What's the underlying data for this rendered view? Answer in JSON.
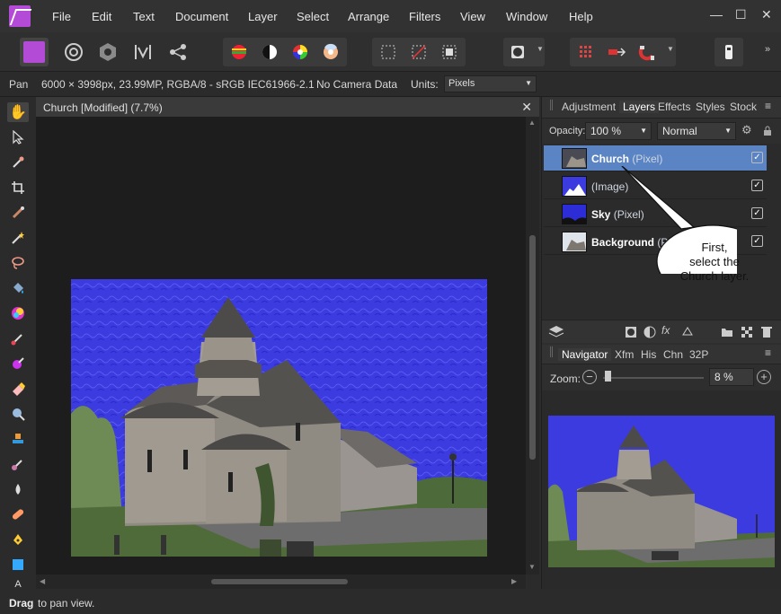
{
  "menu": [
    "File",
    "Edit",
    "Text",
    "Document",
    "Layer",
    "Select",
    "Arrange",
    "Filters",
    "View",
    "Window",
    "Help"
  ],
  "window_controls": {
    "minimize": "—",
    "maximize": "☐",
    "close": "✕"
  },
  "context": {
    "tool": "Pan",
    "doc_info": "6000 × 3998px, 23.99MP, RGBA/8 - sRGB IEC61966-2.1",
    "camera": "No Camera Data",
    "units_label": "Units:",
    "units_value": "Pixels"
  },
  "document": {
    "tab_title": "Church [Modified] (7.7%)",
    "close": "✕"
  },
  "panel_top": {
    "tabs": [
      "Adjustment",
      "Layers",
      "Effects",
      "Styles",
      "Stock"
    ],
    "opacity_label": "Opacity:",
    "opacity_value": "100 %",
    "blend_mode": "Normal",
    "layers": [
      {
        "name": "Church",
        "type": "(Pixel)",
        "selected": true
      },
      {
        "name": "",
        "type": "(Image)",
        "selected": false
      },
      {
        "name": "Sky",
        "type": "(Pixel)",
        "selected": false
      },
      {
        "name": "Background",
        "type": "(Pi",
        "selected": false
      }
    ]
  },
  "callout": {
    "line1": "First,",
    "line2": "select the",
    "line3": "Church layer."
  },
  "panel_bottom": {
    "tabs": [
      "Navigator",
      "Xfm",
      "His",
      "Chn",
      "32P"
    ],
    "zoom_label": "Zoom:",
    "zoom_value": "8 %"
  },
  "status": {
    "bold": "Drag",
    "rest": "to pan view."
  },
  "colors": {
    "accent": "#5b84c4",
    "sky": "#3a3ad8",
    "affinity": "#b34bd6"
  }
}
